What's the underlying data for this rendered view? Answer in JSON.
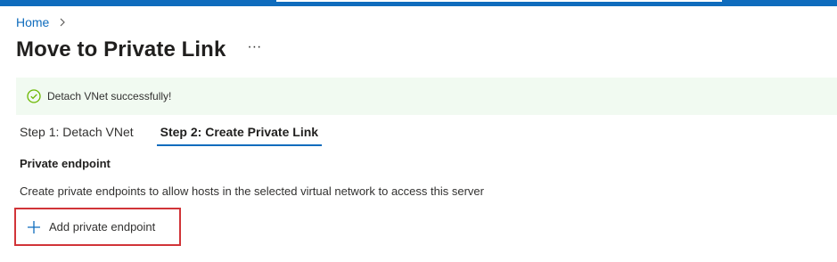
{
  "breadcrumb": {
    "home": "Home"
  },
  "page": {
    "title": "Move to Private Link",
    "more": "···"
  },
  "banner": {
    "message": "Detach VNet successfully!"
  },
  "tabs": [
    {
      "label": "Step 1: Detach VNet",
      "active": false
    },
    {
      "label": "Step 2: Create Private Link",
      "active": true
    }
  ],
  "section": {
    "heading": "Private endpoint",
    "description": "Create private endpoints to allow hosts in the selected virtual network to access this server",
    "add_button": "Add private endpoint"
  },
  "colors": {
    "accent": "#0f6cbd",
    "success": "#6bb700",
    "banner_bg": "#f1faf1",
    "highlight_border": "#d13438"
  },
  "icons": {
    "breadcrumb_separator": "chevron-right-icon",
    "banner": "check-circle-icon",
    "add": "plus-icon"
  }
}
